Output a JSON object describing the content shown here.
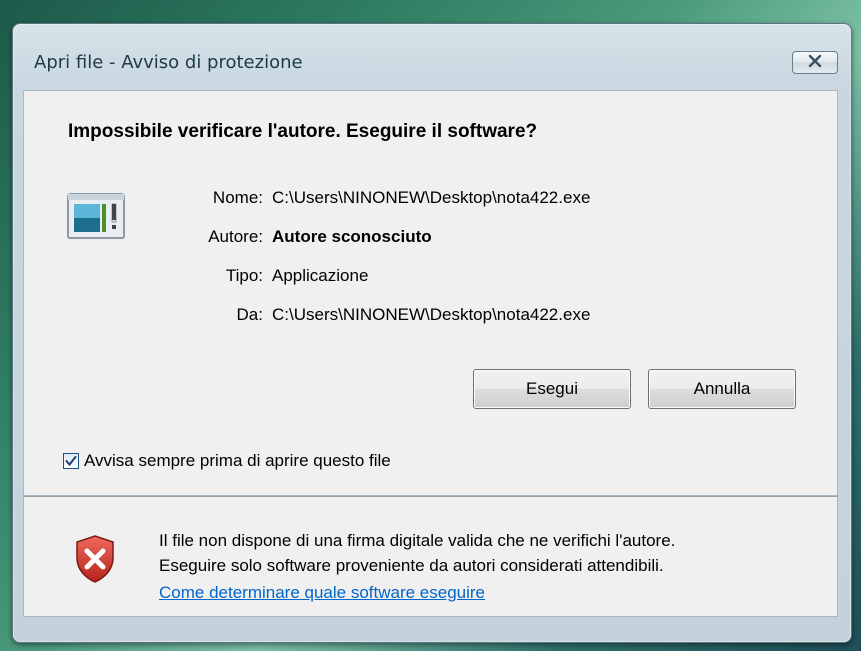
{
  "window": {
    "title": "Apri file - Avviso di protezione"
  },
  "dialog": {
    "heading": "Impossibile verificare l'autore. Eseguire il software?",
    "fields": [
      {
        "label": "Nome:",
        "value": "C:\\Users\\NINONEW\\Desktop\\nota422.exe"
      },
      {
        "label": "Autore:",
        "value": "Autore sconosciuto"
      },
      {
        "label": "Tipo:",
        "value": "Applicazione"
      },
      {
        "label": "Da:",
        "value": "C:\\Users\\NINONEW\\Desktop\\nota422.exe"
      }
    ],
    "buttons": {
      "run_label": "Esegui",
      "cancel_label": "Annulla"
    },
    "checkbox": {
      "label": "Avvisa sempre prima di aprire questo file",
      "checked": true
    }
  },
  "footer": {
    "warning_line1": "Il file non dispone di una firma digitale valida che ne verifichi l'autore.",
    "warning_line2": "Eseguire solo software proveniente da autori considerati attendibili.",
    "link_text": "Come determinare quale software eseguire"
  },
  "icons": {
    "app": "application-icon",
    "shield": "shield-error-icon",
    "close": "close-icon",
    "check": "checkmark-icon"
  },
  "colors": {
    "link": "#0066cc",
    "shield": "#d3322b"
  }
}
